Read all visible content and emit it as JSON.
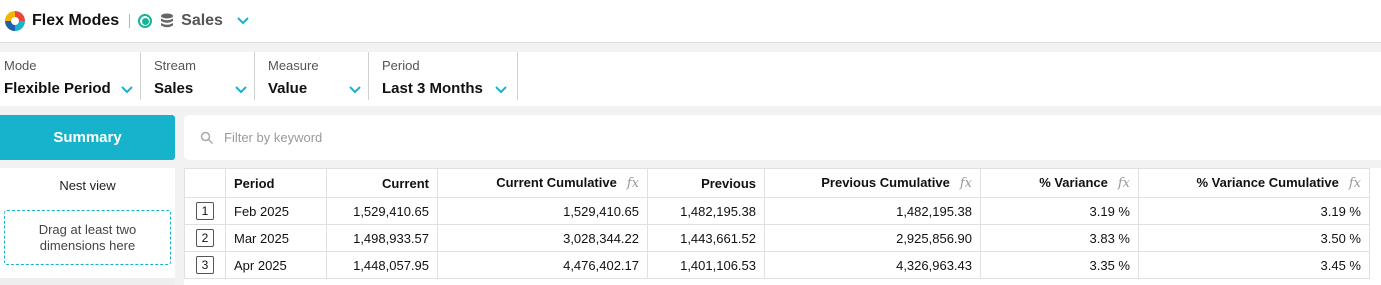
{
  "app": {
    "title": "Flex Modes",
    "dataset": "Sales",
    "colors": {
      "accent": "#17b3cc",
      "status": "#1ab394"
    }
  },
  "filters": [
    {
      "label": "Mode",
      "value": "Flexible Period"
    },
    {
      "label": "Stream",
      "value": "Sales"
    },
    {
      "label": "Measure",
      "value": "Value"
    },
    {
      "label": "Period",
      "value": "Last 3 Months"
    }
  ],
  "summary_button": "Summary",
  "search": {
    "placeholder": "Filter by keyword",
    "value": ""
  },
  "nest": {
    "title": "Nest view",
    "dropzone": "Drag at least two dimensions here"
  },
  "table": {
    "fx_symbol": "fx",
    "columns": [
      "Period",
      "Current",
      "Current Cumulative",
      "Previous",
      "Previous Cumulative",
      "% Variance",
      "% Variance Cumulative"
    ],
    "rows": [
      {
        "n": "1",
        "cells": [
          "Feb 2025",
          "1,529,410.65",
          "1,529,410.65",
          "1,482,195.38",
          "1,482,195.38",
          "3.19 %",
          "3.19 %"
        ]
      },
      {
        "n": "2",
        "cells": [
          "Mar 2025",
          "1,498,933.57",
          "3,028,344.22",
          "1,443,661.52",
          "2,925,856.90",
          "3.83 %",
          "3.50 %"
        ]
      },
      {
        "n": "3",
        "cells": [
          "Apr 2025",
          "1,448,057.95",
          "4,476,402.17",
          "1,401,106.53",
          "4,326,963.43",
          "3.35 %",
          "3.45 %"
        ]
      }
    ]
  }
}
